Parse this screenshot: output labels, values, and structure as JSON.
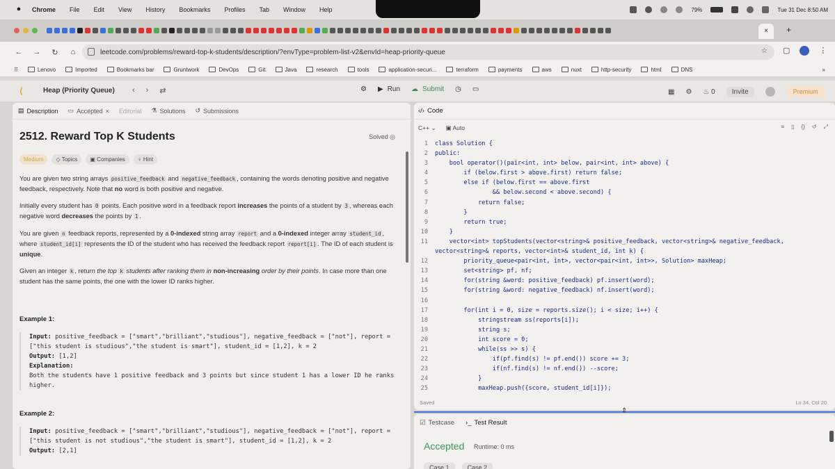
{
  "menubar": {
    "app": "Chrome",
    "items": [
      "File",
      "Edit",
      "View",
      "History",
      "Bookmarks",
      "Profiles",
      "Tab",
      "Window",
      "Help"
    ],
    "battery": "79%",
    "datetime": "Tue 31 Dec  8:50 AM"
  },
  "browser": {
    "url": "leetcode.com/problems/reward-top-k-students/description/?envType=problem-list-v2&envId=heap-priority-queue",
    "active_tab_close": "×",
    "new_tab": "+"
  },
  "bookmarks": [
    "Lenovo",
    "Imported",
    "Bookmarks bar",
    "Gruntwork",
    "DevOps",
    "Git",
    "Java",
    "research",
    "tools",
    "application-securi...",
    "terraform",
    "payments",
    "aws",
    "nuxt",
    "http-security",
    "html",
    "DNS"
  ],
  "lc": {
    "list_title": "Heap (Priority Queue)",
    "run": "Run",
    "submit": "Submit",
    "notif_count": "0",
    "invite": "Invite",
    "premium": "Premium"
  },
  "left": {
    "tabs": {
      "description": "Description",
      "accepted": "Accepted",
      "editorial": "Editorial",
      "solutions": "Solutions",
      "submissions": "Submissions"
    },
    "title": "2512. Reward Top K Students",
    "status": "Solved",
    "chips": {
      "difficulty": "Medium",
      "topics": "Topics",
      "companies": "Companies",
      "hint": "Hint"
    },
    "example1_heading": "Example 1:",
    "example1": {
      "input": "positive_feedback = [\"smart\",\"brilliant\",\"studious\"], negative_feedback = [\"not\"], report = [\"this student is studious\",\"the student is smart\"], student_id = [1,2], k = 2",
      "output": "[1,2]",
      "explanation": "Both the students have 1 positive feedback and 3 points but since student 1 has a lower ID he ranks higher."
    },
    "example2_heading": "Example 2:",
    "example2": {
      "input": "positive_feedback = [\"smart\",\"brilliant\",\"studious\"], negative_feedback = [\"not\"], report = [\"this student is not studious\",\"the student is smart\"], student_id = [1,2], k = 2",
      "output": "[2,1]"
    },
    "labels": {
      "input": "Input:",
      "output": "Output:",
      "explanation": "Explanation:"
    }
  },
  "editor": {
    "header": "Code",
    "language": "C++",
    "mode": "Auto",
    "lines": [
      "class Solution {",
      "public:",
      "    bool operator()(pair<int, int> below, pair<int, int> above) {",
      "        if (below.first > above.first) return false;",
      "        else if (below.first == above.first",
      "                && below.second < above.second) {",
      "            return false;",
      "        }",
      "        return true;",
      "    }",
      "    vector<int> topStudents(vector<string>& positive_feedback, vector<string>& negative_feedback,",
      "vector<string>& reports, vector<int>& student_id, int k) {",
      "        priority_queue<pair<int, int>, vector<pair<int, int>>, Solution> maxHeap;",
      "        set<string> pf, nf;",
      "        for(string &word: positive_feedback) pf.insert(word);",
      "        for(string &word: negative_feedback) nf.insert(word);",
      "",
      "        for(int i = 0, size = reports.size(); i < size; i++) {",
      "            stringstream ss(reports[i]);",
      "            string s;",
      "            int score = 0;",
      "            while(ss >> s) {",
      "                if(pf.find(s) != pf.end()) score += 3;",
      "                if(nf.find(s) != nf.end()) --score;",
      "            }",
      "            maxHeap.push({score, student_id[i]});"
    ],
    "line_numbers": [
      "1",
      "2",
      "3",
      "4",
      "5",
      "6",
      "7",
      "8",
      "9",
      "10",
      "11",
      "",
      "12",
      "13",
      "14",
      "15",
      "16",
      "17",
      "18",
      "19",
      "20",
      "21",
      "22",
      "23",
      "24",
      "25"
    ],
    "saved": "Saved",
    "cursor": "Ln 34, Col 20"
  },
  "result": {
    "tab_testcase": "Testcase",
    "tab_result": "Test Result",
    "status": "Accepted",
    "runtime": "Runtime: 0 ms",
    "case1": "Case 1",
    "case2": "Case 2"
  }
}
